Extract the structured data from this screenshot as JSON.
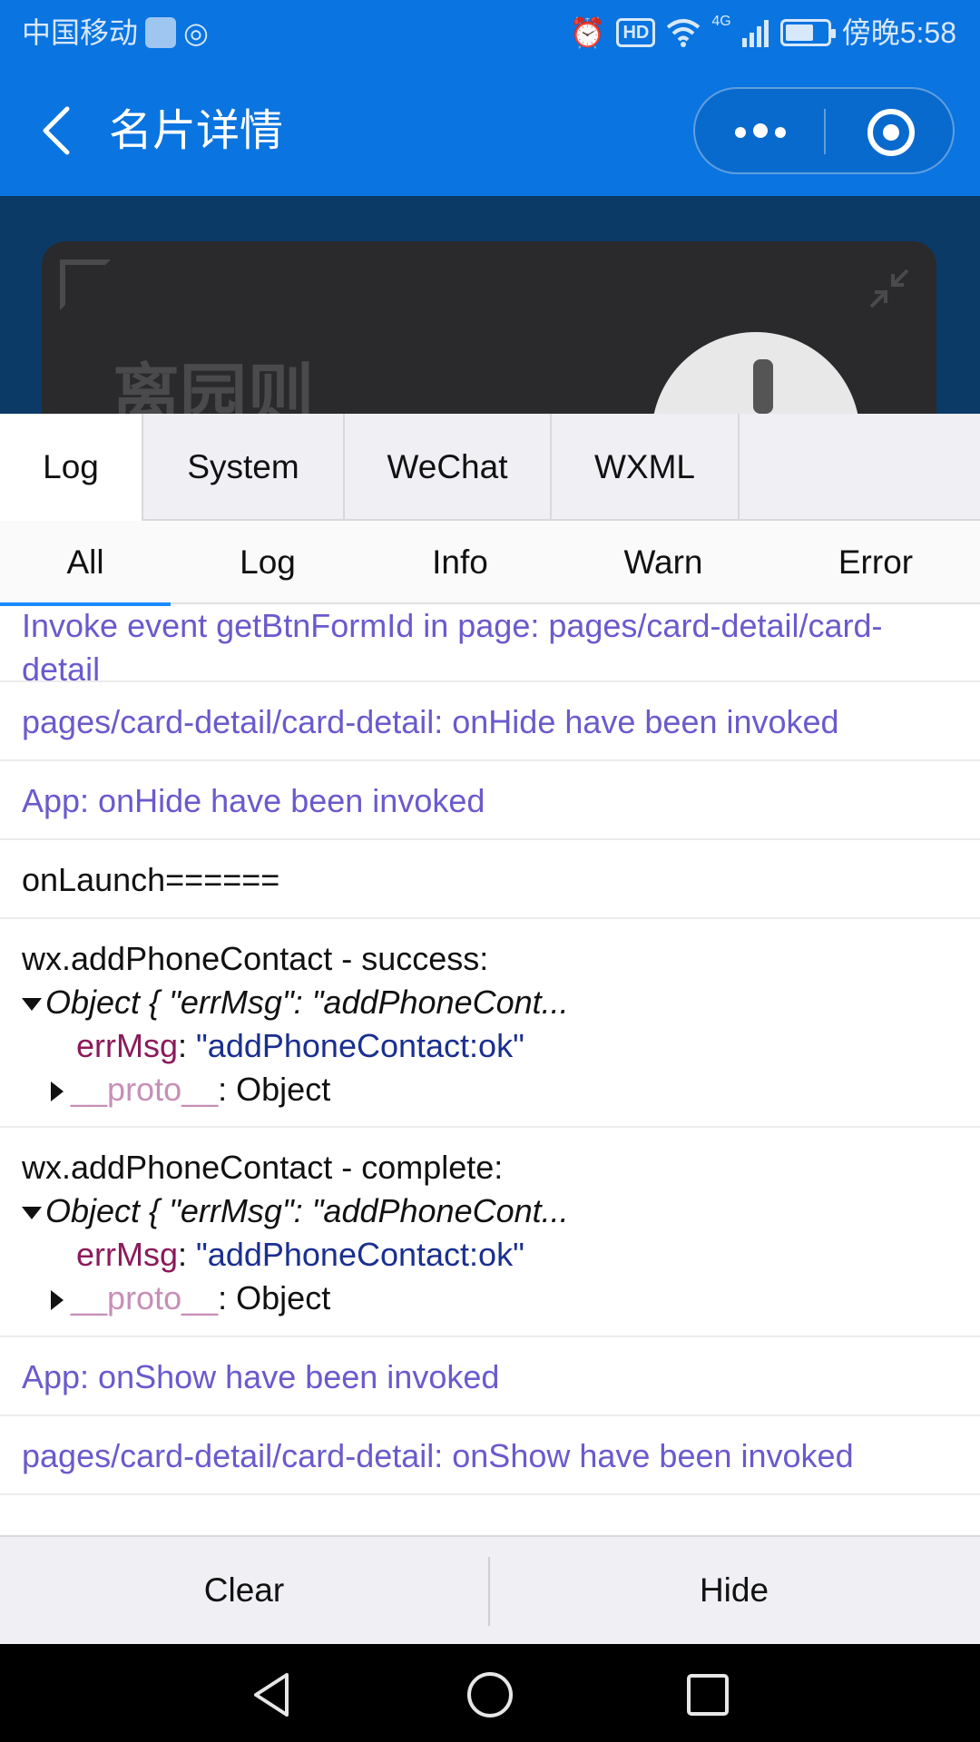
{
  "status_bar": {
    "carrier": "中国移动",
    "hd_label": "HD",
    "network_label": "4G",
    "time": "傍晚5:58",
    "icons": [
      "sim-app-icon",
      "qq-icon",
      "alarm-icon",
      "hd-icon",
      "wifi-icon",
      "signal-icon",
      "battery-icon"
    ]
  },
  "nav": {
    "title": "名片详情",
    "icons": [
      "back-icon",
      "more-icon",
      "target-icon"
    ]
  },
  "card": {
    "name": "离园则",
    "icons": [
      "qr-code-icon",
      "shrink-icon"
    ]
  },
  "debug": {
    "top_tabs": [
      {
        "label": "Log",
        "active": true
      },
      {
        "label": "System",
        "active": false
      },
      {
        "label": "WeChat",
        "active": false
      },
      {
        "label": "WXML",
        "active": false
      }
    ],
    "sub_tabs": [
      {
        "label": "All",
        "active": true
      },
      {
        "label": "Log",
        "active": false
      },
      {
        "label": "Info",
        "active": false
      },
      {
        "label": "Warn",
        "active": false
      },
      {
        "label": "Error",
        "active": false
      }
    ],
    "logs": {
      "e0": "Invoke event getBtnFormId in page: pages/card-detail/card-detail",
      "e1": "pages/card-detail/card-detail: onHide have been invoked",
      "e2": "App: onHide have been invoked",
      "e3": "onLaunch======",
      "e4": {
        "title": "wx.addPhoneContact - success:",
        "object_head": "Object { \"errMsg\": \"addPhoneCont...",
        "key": "errMsg",
        "colon": ": ",
        "value": "\"addPhoneContact:ok\"",
        "proto_key": "__proto__",
        "proto_val": ": Object"
      },
      "e5": {
        "title": "wx.addPhoneContact - complete:",
        "object_head": "Object { \"errMsg\": \"addPhoneCont...",
        "key": "errMsg",
        "colon": ": ",
        "value": "\"addPhoneContact:ok\"",
        "proto_key": "__proto__",
        "proto_val": ": Object"
      },
      "e6": "App: onShow have been invoked",
      "e7": "pages/card-detail/card-detail: onShow have been invoked"
    },
    "actions": {
      "clear": "Clear",
      "hide": "Hide"
    },
    "colors": {
      "system_log": "#6a5acd",
      "key": "#8b1a5a",
      "string_value": "#1a2f8f",
      "proto_key": "#c78fb6",
      "active_indicator": "#1a8aff",
      "nav_background": "#0a74e0"
    }
  },
  "android_nav": {
    "icons": [
      "back-triangle-icon",
      "home-circle-icon",
      "recents-square-icon"
    ]
  }
}
